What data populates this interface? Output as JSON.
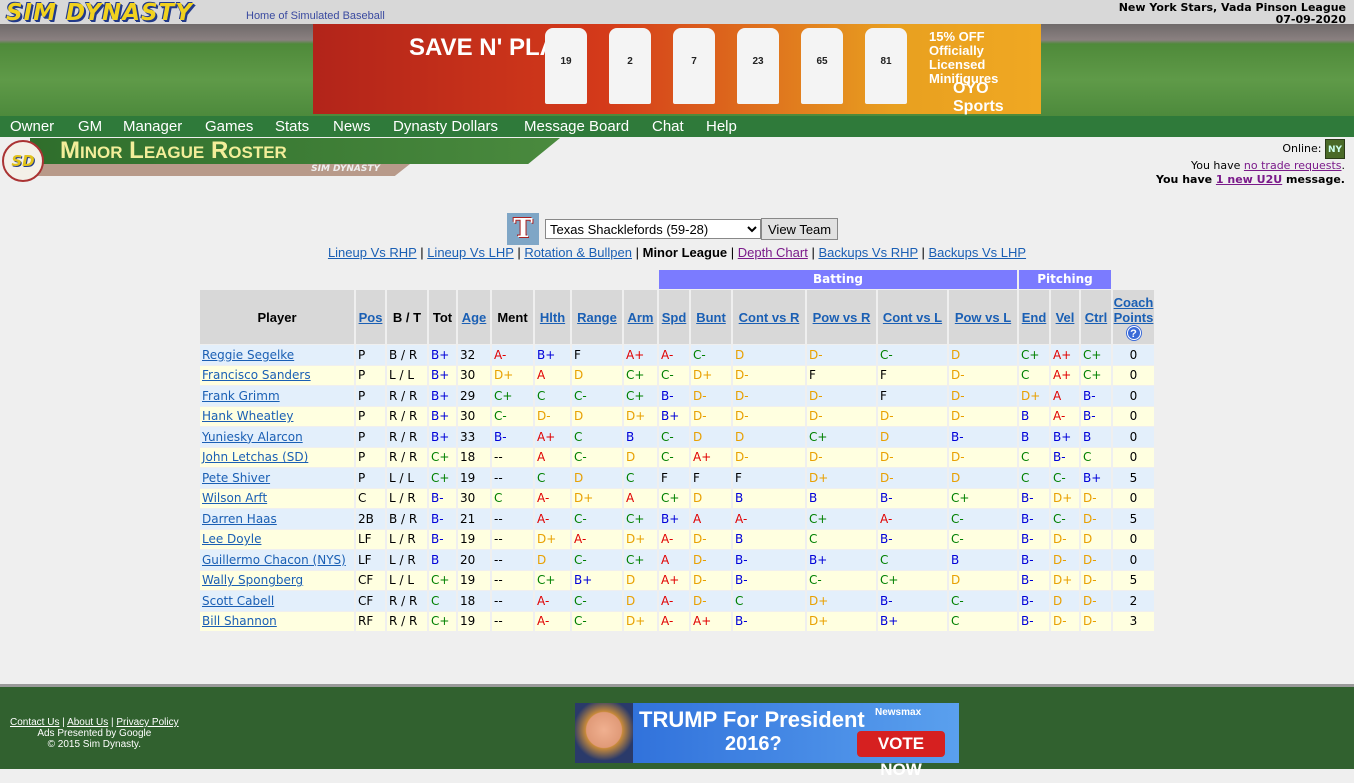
{
  "site": {
    "logo": "SIM DYNASTY",
    "tagline": "Home of Simulated Baseball",
    "team_league": "New York Stars, Vada Pinson League",
    "date": "07-09-2020"
  },
  "ad_top": {
    "headline": "SAVE N' PLAY!",
    "offer": "15% OFF Officially Licensed Minifigures",
    "brand": "OYO Sports SHOP",
    "jersey_numbers": [
      "19",
      "2",
      "7",
      "23",
      "65",
      "81"
    ]
  },
  "nav": [
    "Owner",
    "GM",
    "Manager",
    "Games",
    "Stats",
    "News",
    "Dynasty Dollars",
    "Message Board",
    "Chat",
    "Help"
  ],
  "page": {
    "title": "Minor League Roster",
    "banner_sub": "SIM DYNASTY",
    "badge": "SD"
  },
  "status": {
    "online_label": "Online:",
    "online_badge": "NY",
    "trade_prefix": "You have ",
    "trade_link": "no trade requests",
    "trade_suffix": ".",
    "u2u_prefix": "You have ",
    "u2u_link": "1 new U2U",
    "u2u_suffix": " message."
  },
  "team_select": {
    "logo": "T",
    "selected": "Texas Shacklefords (59-28)",
    "button": "View Team"
  },
  "subnav": [
    {
      "label": "Lineup Vs RHP"
    },
    {
      "label": "Lineup Vs LHP"
    },
    {
      "label": "Rotation & Bullpen"
    },
    {
      "label": "Minor League",
      "current": true
    },
    {
      "label": "Depth Chart",
      "visited": true
    },
    {
      "label": "Backups Vs RHP"
    },
    {
      "label": "Backups Vs LHP"
    }
  ],
  "table": {
    "groups": {
      "batting": "Batting",
      "pitching": "Pitching"
    },
    "columns": [
      {
        "label": "Player"
      },
      {
        "label": "Pos",
        "link": true
      },
      {
        "label": "B / T"
      },
      {
        "label": "Tot"
      },
      {
        "label": "Age",
        "link": true
      },
      {
        "label": "Ment"
      },
      {
        "label": "Hlth",
        "link": true
      },
      {
        "label": "Range",
        "link": true
      },
      {
        "label": "Arm",
        "link": true
      },
      {
        "label": "Spd",
        "link": true
      },
      {
        "label": "Bunt",
        "link": true
      },
      {
        "label": "Cont vs R",
        "link": true
      },
      {
        "label": "Pow vs R",
        "link": true
      },
      {
        "label": "Cont vs L",
        "link": true
      },
      {
        "label": "Pow vs L",
        "link": true
      },
      {
        "label": "End",
        "link": true
      },
      {
        "label": "Vel",
        "link": true
      },
      {
        "label": "Ctrl",
        "link": true
      },
      {
        "label": "Coach Points",
        "link": true,
        "help_icon": "?"
      }
    ],
    "rows": [
      [
        "Reggie Segelke",
        "P",
        "B / R",
        "B+",
        "32",
        "A-",
        "B+",
        "F",
        "A+",
        "A-",
        "C-",
        "D",
        "D-",
        "C-",
        "D",
        "C+",
        "A+",
        "C+",
        "0"
      ],
      [
        "Francisco Sanders",
        "P",
        "L / L",
        "B+",
        "30",
        "D+",
        "A",
        "D",
        "C+",
        "C-",
        "D+",
        "D-",
        "F",
        "F",
        "D-",
        "C",
        "A+",
        "C+",
        "0"
      ],
      [
        "Frank Grimm",
        "P",
        "R / R",
        "B+",
        "29",
        "C+",
        "C",
        "C-",
        "C+",
        "B-",
        "D-",
        "D-",
        "D-",
        "F",
        "D-",
        "D+",
        "A",
        "B-",
        "0"
      ],
      [
        "Hank Wheatley",
        "P",
        "R / R",
        "B+",
        "30",
        "C-",
        "D-",
        "D",
        "D+",
        "B+",
        "D-",
        "D-",
        "D-",
        "D-",
        "D-",
        "B",
        "A-",
        "B-",
        "0"
      ],
      [
        "Yuniesky Alarcon",
        "P",
        "R / R",
        "B+",
        "33",
        "B-",
        "A+",
        "C",
        "B",
        "C-",
        "D",
        "D",
        "C+",
        "D",
        "B-",
        "B",
        "B+",
        "B",
        "0"
      ],
      [
        "John Letchas (SD)",
        "P",
        "R / R",
        "C+",
        "18",
        "--",
        "A",
        "C-",
        "D",
        "C-",
        "A+",
        "D-",
        "D-",
        "D-",
        "D-",
        "C",
        "B-",
        "C",
        "0"
      ],
      [
        "Pete Shiver",
        "P",
        "L / L",
        "C+",
        "19",
        "--",
        "C",
        "D",
        "C",
        "F",
        "F",
        "F",
        "D+",
        "D-",
        "D",
        "C",
        "C-",
        "B+",
        "5"
      ],
      [
        "Wilson Arft",
        "C",
        "L / R",
        "B-",
        "30",
        "C",
        "A-",
        "D+",
        "A",
        "C+",
        "D",
        "B",
        "B",
        "B-",
        "C+",
        "B-",
        "D+",
        "D-",
        "0"
      ],
      [
        "Darren Haas",
        "2B",
        "B / R",
        "B-",
        "21",
        "--",
        "A-",
        "C-",
        "C+",
        "B+",
        "A",
        "A-",
        "C+",
        "A-",
        "C-",
        "B-",
        "C-",
        "D-",
        "5"
      ],
      [
        "Lee Doyle",
        "LF",
        "L / R",
        "B-",
        "19",
        "--",
        "D+",
        "A-",
        "D+",
        "A-",
        "D-",
        "B",
        "C",
        "B-",
        "C-",
        "B-",
        "D-",
        "D",
        "0"
      ],
      [
        "Guillermo Chacon (NYS)",
        "LF",
        "L / R",
        "B",
        "20",
        "--",
        "D",
        "C-",
        "C+",
        "A",
        "D-",
        "B-",
        "B+",
        "C",
        "B",
        "B-",
        "D-",
        "D-",
        "0"
      ],
      [
        "Wally Spongberg",
        "CF",
        "L / L",
        "C+",
        "19",
        "--",
        "C+",
        "B+",
        "D",
        "A+",
        "D-",
        "B-",
        "C-",
        "C+",
        "D",
        "B-",
        "D+",
        "D-",
        "5"
      ],
      [
        "Scott Cabell",
        "CF",
        "R / R",
        "C",
        "18",
        "--",
        "A-",
        "C-",
        "D",
        "A-",
        "D-",
        "C",
        "D+",
        "B-",
        "C-",
        "B-",
        "D",
        "D-",
        "2"
      ],
      [
        "Bill Shannon",
        "RF",
        "R / R",
        "C+",
        "19",
        "--",
        "A-",
        "C-",
        "D+",
        "A-",
        "A+",
        "B-",
        "D+",
        "B+",
        "C",
        "B-",
        "D-",
        "D-",
        "3"
      ]
    ]
  },
  "grade_colors": {
    "A": "#e00000",
    "B": "#0000d8",
    "C": "#008000",
    "D": "#e8a000",
    "F": "#000000"
  },
  "footer": {
    "links": [
      "Contact Us",
      "About Us",
      "Privacy Policy"
    ],
    "ads_line": "Ads Presented by Google",
    "copyright": "© 2015 Sim Dynasty."
  },
  "ad_bottom": {
    "headline": "TRUMP For President",
    "year": "2016?",
    "button": "VOTE NOW",
    "brand": "Newsmax"
  }
}
